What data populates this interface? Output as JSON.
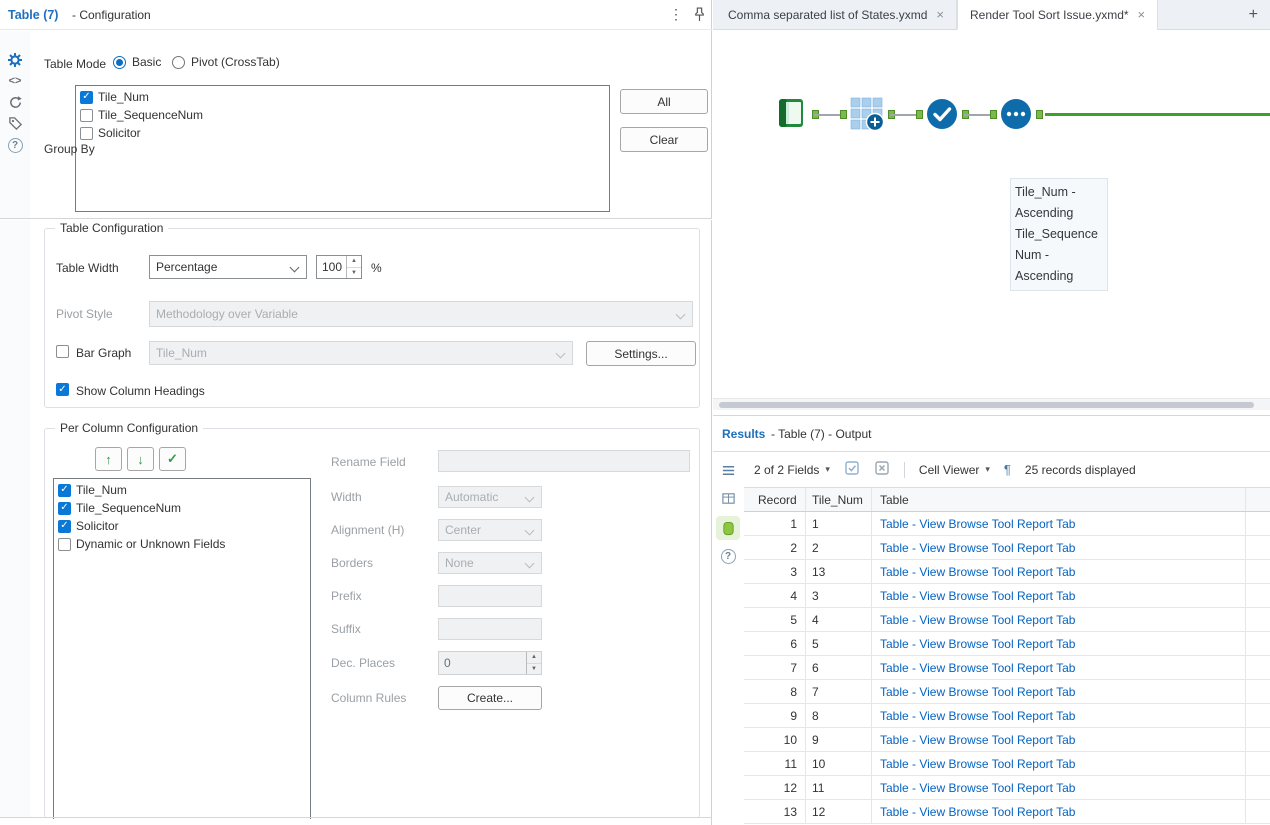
{
  "colors": {
    "accent_blue": "#1e6fbe",
    "tool_blue": "#0e6cab",
    "connector_green": "#7cb94c",
    "wire_green": "#3fa02e",
    "check_blue": "#0a78d7",
    "link_blue": "#0563c1"
  },
  "icons": {
    "kebab": "⋮",
    "caret_down": "▾",
    "pilcrow": "¶",
    "question": "?",
    "code": "<>",
    "up_arrow": "↑",
    "down_arrow": "↓",
    "check": "✓",
    "plus": "+",
    "spinner_up": "▲",
    "spinner_down": "▼"
  },
  "config_panel": {
    "title": "Table (7)",
    "subtitle": "- Configuration",
    "table_mode": {
      "label": "Table Mode",
      "options": [
        {
          "label": "Basic",
          "selected": true
        },
        {
          "label": "Pivot (CrossTab)",
          "selected": false
        }
      ]
    },
    "group_by": {
      "label": "Group By",
      "items": [
        {
          "label": "Tile_Num",
          "checked": true
        },
        {
          "label": "Tile_SequenceNum",
          "checked": false
        },
        {
          "label": "Solicitor",
          "checked": false
        }
      ],
      "all_button": "All",
      "clear_button": "Clear"
    },
    "table_configuration": {
      "legend": "Table Configuration",
      "table_width_label": "Table Width",
      "table_width_mode": "Percentage",
      "table_width_value": "100",
      "table_width_unit": "%",
      "pivot_style_label": "Pivot Style",
      "pivot_style_value": "Methodology over Variable",
      "bar_graph_label": "Bar Graph",
      "bar_graph_checked": false,
      "bar_graph_field": "Tile_Num",
      "settings_button": "Settings...",
      "show_column_headings_label": "Show Column Headings",
      "show_column_headings_checked": true
    },
    "per_column": {
      "legend": "Per Column Configuration",
      "fields": [
        {
          "label": "Tile_Num",
          "checked": true
        },
        {
          "label": "Tile_SequenceNum",
          "checked": true
        },
        {
          "label": "Solicitor",
          "checked": true
        },
        {
          "label": "Dynamic or Unknown Fields",
          "checked": false
        }
      ],
      "rename_field_label": "Rename Field",
      "rename_field_value": "",
      "width_label": "Width",
      "width_value": "Automatic",
      "alignment_label": "Alignment (H)",
      "alignment_value": "Center",
      "borders_label": "Borders",
      "borders_value": "None",
      "prefix_label": "Prefix",
      "prefix_value": "",
      "suffix_label": "Suffix",
      "suffix_value": "",
      "dec_places_label": "Dec. Places",
      "dec_places_value": "0",
      "column_rules_label": "Column Rules",
      "create_button": "Create..."
    }
  },
  "document_tabs": {
    "tabs": [
      {
        "label": "Comma separated list of States.yxmd",
        "active": false
      },
      {
        "label": "Render Tool Sort Issue.yxmd*",
        "active": true
      }
    ],
    "close_glyph": "×",
    "new_tab_glyph": "+"
  },
  "canvas": {
    "tools": [
      "input-data-tool",
      "tile-tool",
      "select-tool",
      "sort-tool"
    ],
    "annotation": "Tile_Num - Ascending Tile_SequenceNum - Ascending"
  },
  "results": {
    "title": "Results",
    "subtitle": "- Table (7) - Output",
    "toolbar": {
      "fields_dropdown": "2 of 2 Fields",
      "cell_viewer_dropdown": "Cell Viewer",
      "records_text": "25 records displayed"
    },
    "grid": {
      "columns": [
        "Record",
        "Tile_Num",
        "Table"
      ],
      "rows": [
        [
          "1",
          "1",
          "Table - View Browse Tool Report Tab"
        ],
        [
          "2",
          "2",
          "Table - View Browse Tool Report Tab"
        ],
        [
          "3",
          "13",
          "Table - View Browse Tool Report Tab"
        ],
        [
          "4",
          "3",
          "Table - View Browse Tool Report Tab"
        ],
        [
          "5",
          "4",
          "Table - View Browse Tool Report Tab"
        ],
        [
          "6",
          "5",
          "Table - View Browse Tool Report Tab"
        ],
        [
          "7",
          "6",
          "Table - View Browse Tool Report Tab"
        ],
        [
          "8",
          "7",
          "Table - View Browse Tool Report Tab"
        ],
        [
          "9",
          "8",
          "Table - View Browse Tool Report Tab"
        ],
        [
          "10",
          "9",
          "Table - View Browse Tool Report Tab"
        ],
        [
          "11",
          "10",
          "Table - View Browse Tool Report Tab"
        ],
        [
          "12",
          "11",
          "Table - View Browse Tool Report Tab"
        ],
        [
          "13",
          "12",
          "Table - View Browse Tool Report Tab"
        ]
      ]
    }
  }
}
